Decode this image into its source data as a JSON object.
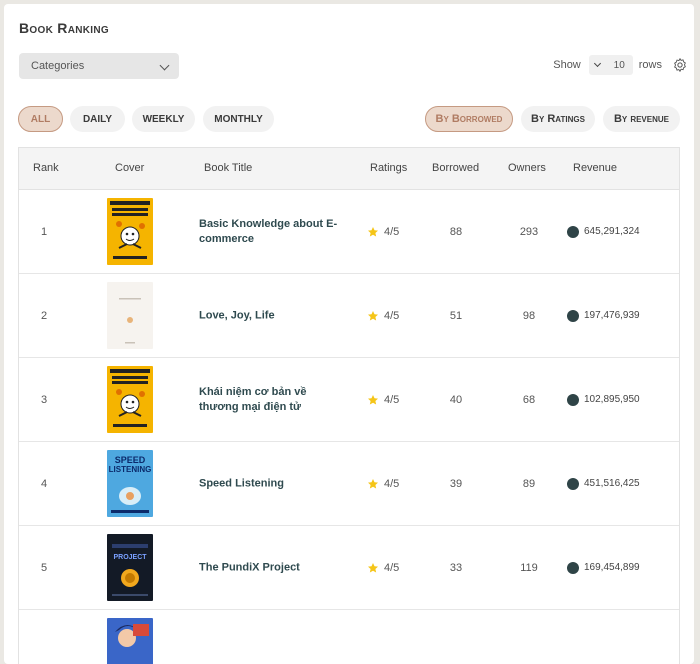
{
  "page_title": "Book Ranking",
  "categories": {
    "label": "Categories"
  },
  "show": {
    "label": "Show",
    "value": "10",
    "rows_label": "rows"
  },
  "period_filters": [
    {
      "label": "ALL",
      "active": true
    },
    {
      "label": "DAILY",
      "active": false
    },
    {
      "label": "WEEKLY",
      "active": false
    },
    {
      "label": "MONTHLY",
      "active": false
    }
  ],
  "sort_filters": [
    {
      "label": "By Borrowed",
      "active": true
    },
    {
      "label": "By Ratings",
      "active": false
    },
    {
      "label": "By revenue",
      "active": false
    }
  ],
  "columns": [
    "Rank",
    "Cover",
    "Book Title",
    "Ratings",
    "Borrowed",
    "Owners",
    "Revenue"
  ],
  "rows": [
    {
      "rank": "1",
      "cover": "yellow-cartoon",
      "title": "Basic Knowledge about E-commerce",
      "rating": "4/5",
      "borrowed": "88",
      "owners": "293",
      "revenue": "645,291,324"
    },
    {
      "rank": "2",
      "cover": "white-minimal",
      "title": "Love, Joy, Life",
      "rating": "4/5",
      "borrowed": "51",
      "owners": "98",
      "revenue": "197,476,939"
    },
    {
      "rank": "3",
      "cover": "yellow-cartoon",
      "title": "Khái niệm cơ bản về thương mại điện tử",
      "rating": "4/5",
      "borrowed": "40",
      "owners": "68",
      "revenue": "102,895,950"
    },
    {
      "rank": "4",
      "cover": "blue-speed",
      "title": "Speed Listening",
      "rating": "4/5",
      "borrowed": "39",
      "owners": "89",
      "revenue": "451,516,425"
    },
    {
      "rank": "5",
      "cover": "dark-project",
      "title": "The PundiX Project",
      "rating": "4/5",
      "borrowed": "33",
      "owners": "119",
      "revenue": "169,454,899"
    },
    {
      "rank": "",
      "cover": "anime-blue",
      "title": "",
      "rating": "",
      "borrowed": "",
      "owners": "",
      "revenue": ""
    }
  ]
}
